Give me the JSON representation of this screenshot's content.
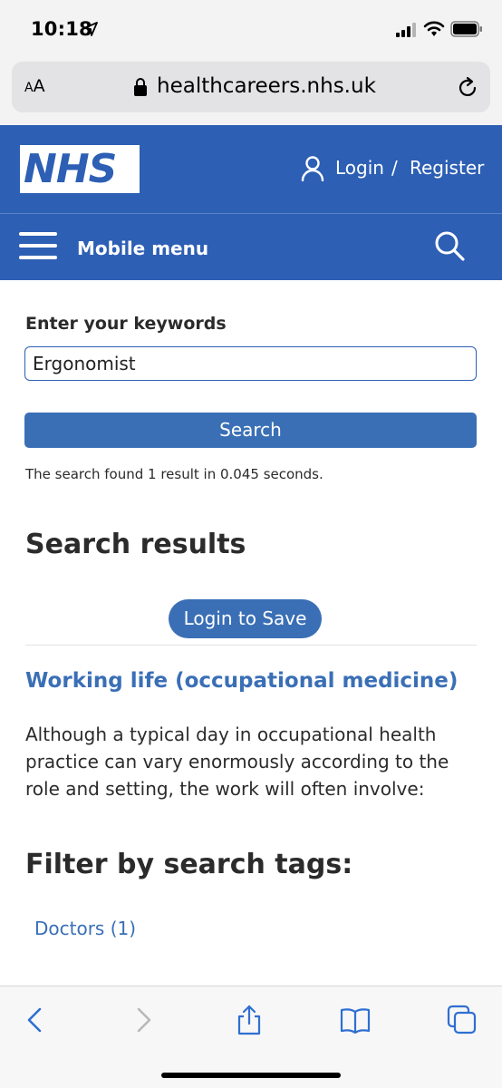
{
  "status_bar": {
    "time": "10:18",
    "icons": [
      "location-arrow-icon",
      "cellular-signal-icon",
      "wifi-icon",
      "battery-icon"
    ]
  },
  "browser": {
    "text_size_label_small": "A",
    "text_size_label_large": "A",
    "url": "healthcareers.nhs.uk"
  },
  "header": {
    "logo_text": "NHS",
    "login_label": "Login",
    "separator": "/",
    "register_label": "Register"
  },
  "nav": {
    "menu_label": "Mobile menu"
  },
  "search": {
    "label": "Enter your keywords",
    "value": "Ergonomist",
    "button_label": "Search",
    "summary": "The search found 1 result in 0.045 seconds."
  },
  "results": {
    "title": "Search results",
    "save_button_label": "Login to Save",
    "items": [
      {
        "title": "Working life (occupational medicine)",
        "description": "Although a typical day in occupational health practice can vary enormously according to the role and setting, the work will often involve:"
      }
    ]
  },
  "filters": {
    "title": "Filter by search tags:",
    "tags": [
      {
        "label": "Doctors (1)"
      }
    ]
  },
  "toolbar": {
    "icons": [
      "back-icon",
      "forward-icon",
      "share-icon",
      "bookmarks-icon",
      "tabs-icon"
    ]
  },
  "colors": {
    "nhs_blue": "#2d5fb4",
    "link_blue": "#3a6fb6",
    "text_dark": "#2b2b2b"
  }
}
